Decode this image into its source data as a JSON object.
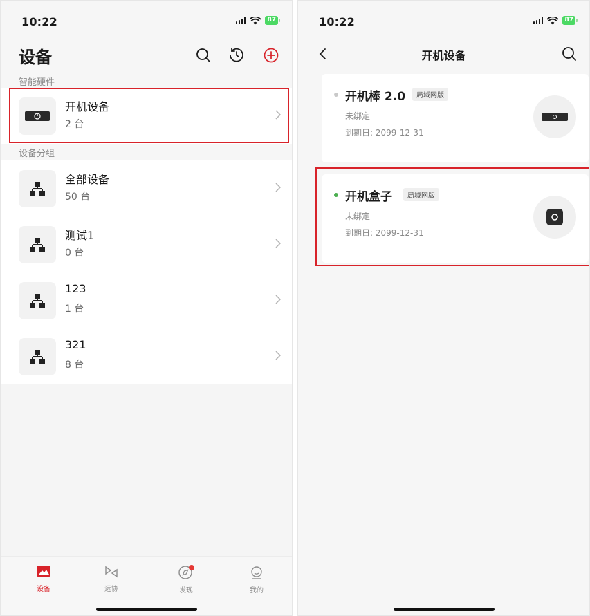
{
  "left": {
    "status": {
      "time": "10:22",
      "battery": "87"
    },
    "title": "设备",
    "section_smart": "智能硬件",
    "power_device": {
      "title": "开机设备",
      "count": "2 台"
    },
    "section_groups": "设备分组",
    "groups": [
      {
        "title": "全部设备",
        "count": "50 台"
      },
      {
        "title": "测试1",
        "count": "0 台"
      },
      {
        "title": "123",
        "count": "1 台"
      },
      {
        "title": "321",
        "count": "8 台"
      }
    ],
    "tabs": [
      {
        "label": "设备"
      },
      {
        "label": "远协"
      },
      {
        "label": "发现"
      },
      {
        "label": "我的"
      }
    ]
  },
  "right": {
    "status": {
      "time": "10:22",
      "battery": "87"
    },
    "nav_title": "开机设备",
    "devices": [
      {
        "name": "开机棒 2.0",
        "tag": "局域网版",
        "status": "未绑定",
        "expire": "到期日: 2099-12-31",
        "online_color": "#c9c9c9"
      },
      {
        "name": "开机盒子",
        "tag": "局域网版",
        "status": "未绑定",
        "expire": "到期日: 2099-12-31",
        "online_color": "#4caf50"
      }
    ]
  },
  "colors": {
    "accent": "#d8232a",
    "online": "#4caf50",
    "offline": "#c9c9c9",
    "battery": "#4cd964"
  },
  "icons": [
    "search-icon",
    "history-icon",
    "add-circle-icon",
    "back-chevron-icon",
    "chevron-right-icon",
    "network-group-icon",
    "power-icon",
    "devices-tab-icon",
    "remote-tab-icon",
    "discover-compass-icon",
    "profile-tab-icon"
  ]
}
